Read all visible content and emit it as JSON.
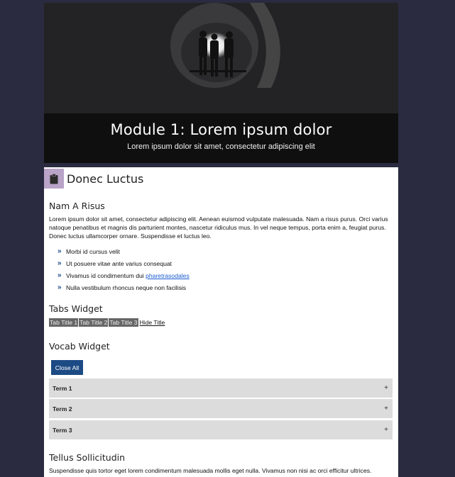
{
  "hero": {
    "title": "Module 1: Lorem ipsum dolor",
    "subtitle": "Lorem ipsum dolor sit amet, consectetur adipiscing elit"
  },
  "section": {
    "icon": "clipboard-icon",
    "title": "Donec Luctus"
  },
  "intro": {
    "heading": "Nam A Risus",
    "paragraph": "Lorem ipsum dolor sit amet, consectetur adipiscing elit. Aenean euismod vulputate malesuada. Nam a risus purus. Orci varius natoque penatibus et magnis dis parturient montes, nascetur ridiculus mus. In vel neque tempus, porta enim a, feugiat purus. Donec luctus ullamcorper ornare. Suspendisse et luctus leo.",
    "bullets": [
      "Morbi id cursus velit",
      "Ut posuere vitae ante varius consequat",
      "Vivamus id condimentum dui",
      "Nulla vestibulum rhoncus neque non facilisis"
    ],
    "bullet_link": "pharetrasodales"
  },
  "tabs_widget": {
    "heading": "Tabs Widget",
    "tabs": [
      "Tab Title 1",
      "Tab Title 2",
      "Tab Title 3"
    ],
    "hide_label": "Hide Title"
  },
  "vocab_widget": {
    "heading": "Vocab Widget",
    "close_all_label": "Close All",
    "terms": [
      "Term 1",
      "Term 2",
      "Term 3"
    ],
    "expand_symbol": "+"
  },
  "outro": {
    "heading": "Tellus Sollicitudin",
    "paragraph": "Suspendisse quis tortor eget lorem condimentum malesuada mollis eget nulla. Vivamus non nisi ac orci efficitur ultrices."
  },
  "colors": {
    "page_bg": "#2a2a40",
    "badge": "#b9a3c7",
    "button": "#1c4a84",
    "link": "#1a5bd1",
    "accordion": "#dcdcdc"
  }
}
